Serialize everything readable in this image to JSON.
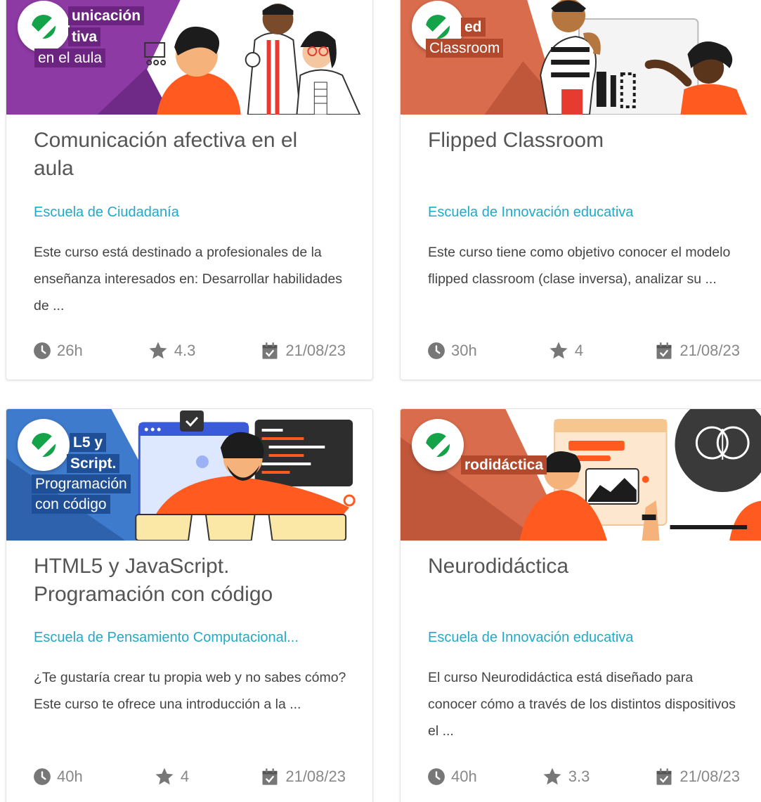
{
  "colors": {
    "title": "#555555",
    "school_link": "#22a8c8",
    "description": "#444444",
    "meta": "#888888",
    "completed_check": "#15a34a"
  },
  "courses": [
    {
      "banner_lines": [
        "unicación",
        "tiva",
        "en el aula"
      ],
      "title": "Comunicación afectiva en el aula",
      "school": "Escuela de Ciudadanía",
      "description": "Este curso está destinado a profesionales de la enseñanza interesados en: Desarrollar habilidades de ...",
      "duration": "26h",
      "rating": "4.3",
      "date": "21/08/23",
      "completed": true
    },
    {
      "banner_lines": [
        "ed",
        "Classroom"
      ],
      "title": "Flipped Classroom",
      "school": "Escuela de Innovación educativa",
      "description": "Este curso tiene como objetivo conocer el modelo flipped classroom (clase inversa), analizar su ...",
      "duration": "30h",
      "rating": "4",
      "date": "21/08/23",
      "completed": true
    },
    {
      "banner_lines": [
        "L5 y",
        "Script.",
        "Programación",
        "con código"
      ],
      "title": "HTML5 y JavaScript. Programación con código",
      "school": "Escuela de Pensamiento Computacional...",
      "description": "¿Te gustaría crear tu propia web y no sabes cómo? Este curso te ofrece una introducción a la ...",
      "duration": "40h",
      "rating": "4",
      "date": "21/08/23",
      "completed": true
    },
    {
      "banner_lines": [
        "rodidáctica"
      ],
      "title": "Neurodidáctica",
      "school": "Escuela de Innovación educativa",
      "description": "El curso Neurodidáctica está diseñado para conocer cómo a través de los distintos dispositivos el ...",
      "duration": "40h",
      "rating": "3.3",
      "date": "21/08/23",
      "completed": true
    }
  ]
}
